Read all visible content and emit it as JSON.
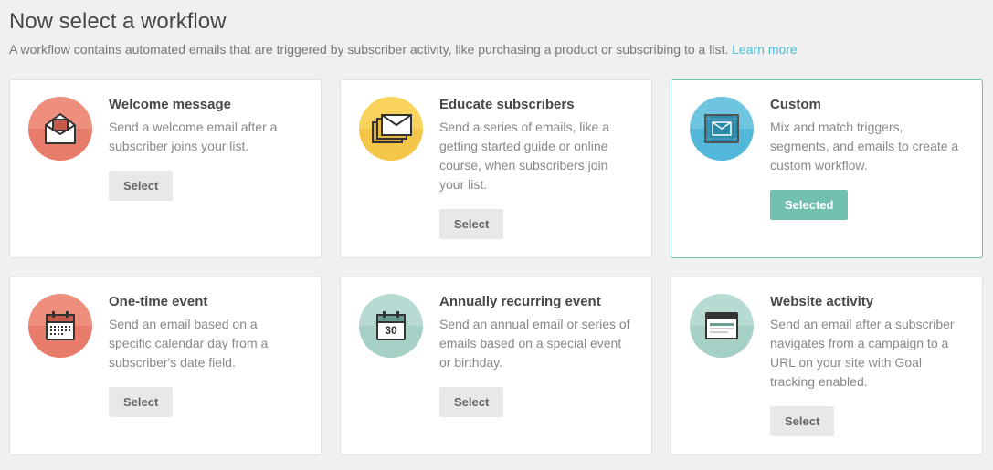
{
  "header": {
    "title": "Now select a workflow",
    "description_pre": "A workflow contains automated emails that are triggered by subscriber activity, like purchasing a product or subscribing to a list. ",
    "learn_more": "Learn more"
  },
  "buttons": {
    "select": "Select",
    "selected": "Selected"
  },
  "colors": {
    "coral_top": "#ee8e7c",
    "coral_bot": "#e77c6a",
    "yellow_top": "#f9d35b",
    "yellow_bot": "#f3c647",
    "blue_top": "#6dc5e0",
    "blue_bot": "#52b7d8",
    "mint_top": "#b7dbd3",
    "mint_bot": "#a5d0c6"
  },
  "cards": [
    {
      "key": "welcome",
      "title": "Welcome message",
      "desc": "Send a welcome email after a subscriber joins your list.",
      "icon": "envelope-open",
      "palette": "coral",
      "selected": false
    },
    {
      "key": "educate",
      "title": "Educate subscribers",
      "desc": "Send a series of emails, like a getting started guide or online course, when subscribers join your list.",
      "icon": "envelope-stack",
      "palette": "yellow",
      "selected": false
    },
    {
      "key": "custom",
      "title": "Custom",
      "desc": "Mix and match triggers, segments, and emails to create a custom workflow.",
      "icon": "blueprint",
      "palette": "blue",
      "selected": true
    },
    {
      "key": "onetime",
      "title": "One-time event",
      "desc": "Send an email based on a specific calendar day from a subscriber's date field.",
      "icon": "calendar",
      "palette": "coral",
      "selected": false
    },
    {
      "key": "annual",
      "title": "Annually recurring event",
      "desc": "Send an annual email or series of emails based on a special event or birthday.",
      "icon": "calendar-30",
      "palette": "mint",
      "selected": false
    },
    {
      "key": "website",
      "title": "Website activity",
      "desc": "Send an email after a subscriber navigates from a campaign to a URL on your site with Goal tracking enabled.",
      "icon": "browser",
      "palette": "mint",
      "selected": false
    }
  ]
}
